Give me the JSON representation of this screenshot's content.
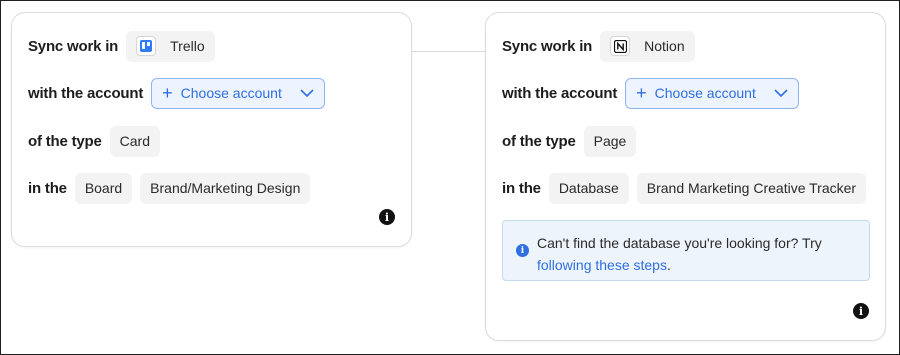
{
  "left": {
    "sync_label": "Sync work in",
    "app_name": "Trello",
    "account_label": "with the account",
    "account_button": "Choose account",
    "type_label": "of the type",
    "type_value": "Card",
    "in_label": "in the",
    "container_type": "Board",
    "container_name": "Brand/Marketing Design",
    "info_glyph": "i"
  },
  "right": {
    "sync_label": "Sync work in",
    "app_name": "Notion",
    "account_label": "with the account",
    "account_button": "Choose account",
    "type_label": "of the type",
    "type_value": "Page",
    "in_label": "in the",
    "container_type": "Database",
    "container_name": "Brand Marketing Creative Tracker",
    "notice_text": "Can't find the database you're looking for? Try",
    "notice_link": "following these steps",
    "notice_end": ".",
    "info_glyph": "i"
  },
  "icons": {
    "trello": "trello-icon",
    "notion": "notion-icon",
    "plus": "plus-icon",
    "chevron": "chevron-down-icon",
    "info": "info-icon"
  },
  "colors": {
    "accent": "#2f6fe0",
    "trello_blue": "#2d7cf6",
    "notice_bg": "#eef4fb"
  }
}
